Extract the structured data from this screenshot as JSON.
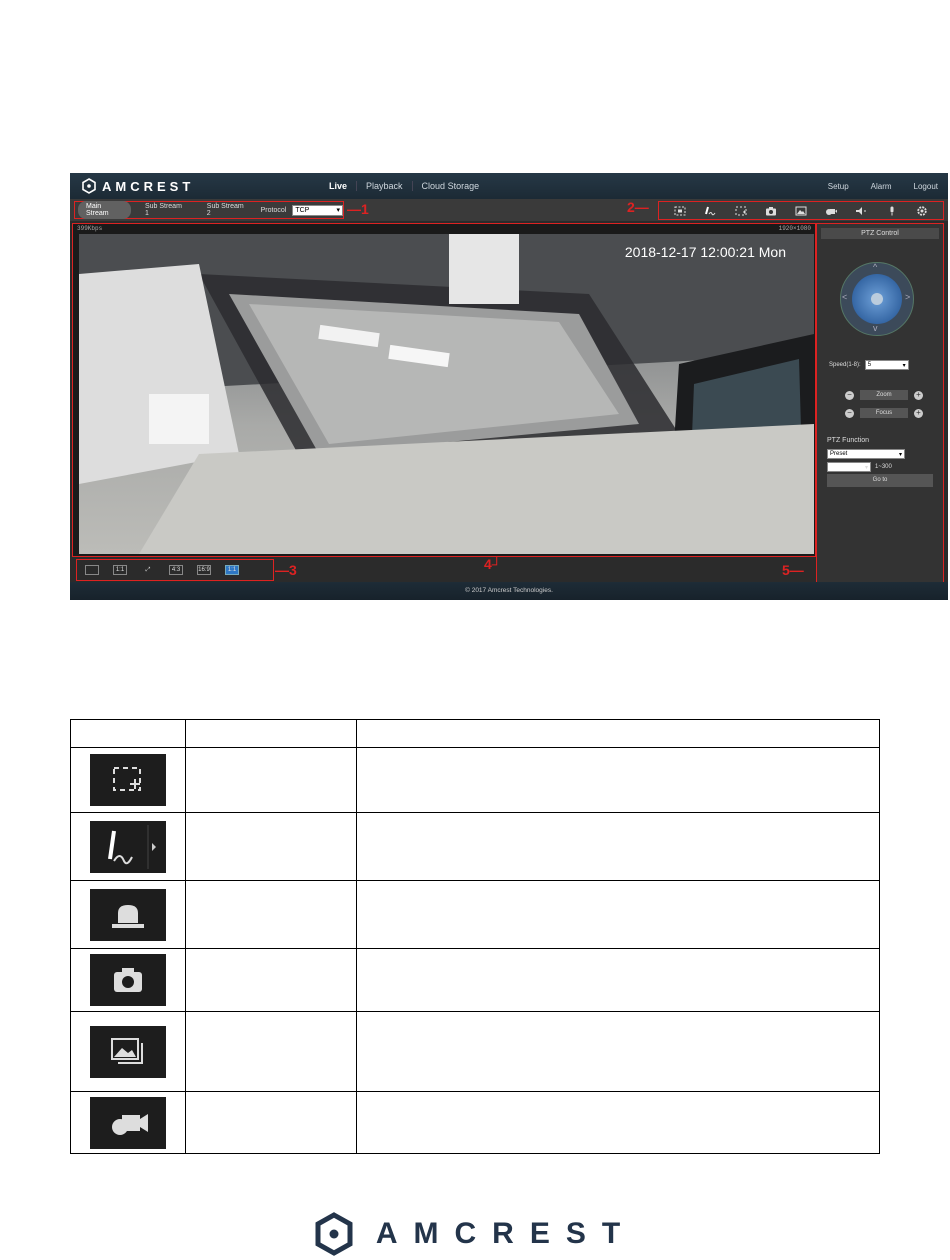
{
  "app": {
    "logo_text": "AMCREST",
    "nav": [
      "Live",
      "Playback",
      "Cloud Storage"
    ],
    "right_nav": [
      "Setup",
      "Alarm",
      "Logout"
    ]
  },
  "toolbar": {
    "streams": [
      "Main Stream",
      "Sub Stream 1",
      "Sub Stream 2"
    ],
    "protocol_label": "Protocol",
    "protocol_value": "TCP"
  },
  "callouts": [
    "1",
    "2",
    "3",
    "4",
    "5"
  ],
  "video": {
    "bitrate": "399Kbps",
    "resolution": "1920×1080",
    "timestamp": "2018-12-17 12:00:21 Mon"
  },
  "bottom_tools": [
    "",
    "1:1",
    "",
    "4:3",
    "16:9",
    "1:1"
  ],
  "ptz": {
    "title": "PTZ Control",
    "speed_label": "Speed(1-8):",
    "speed_value": "5",
    "zoom_label": "Zoom",
    "focus_label": "Focus",
    "function_label": "PTZ Function",
    "function_value": "Preset",
    "range_label": "1~300",
    "goto_label": "Go to"
  },
  "footer_text": "© 2017 Amcrest Technologies.",
  "doc_footer_logo": "AMCREST"
}
